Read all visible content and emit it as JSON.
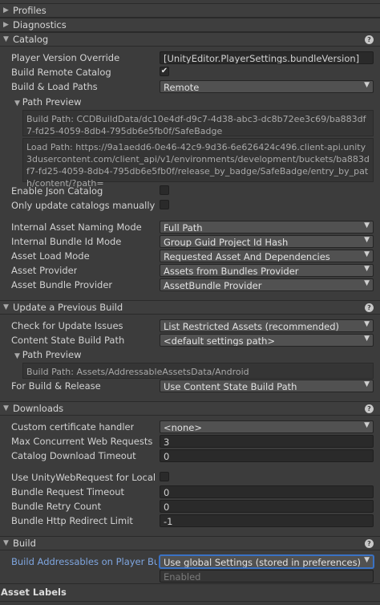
{
  "sections": {
    "profiles": "Profiles",
    "diagnostics": "Diagnostics",
    "catalog": "Catalog",
    "update_previous_build": "Update a Previous Build",
    "downloads": "Downloads",
    "build": "Build",
    "asset_labels": "Asset Labels"
  },
  "help_glyph": "?",
  "catalog": {
    "player_version_override_label": "Player Version Override",
    "player_version_override_value": "[UnityEditor.PlayerSettings.bundleVersion]",
    "build_remote_catalog_label": "Build Remote Catalog",
    "build_remote_catalog_checked": true,
    "build_load_paths_label": "Build & Load Paths",
    "build_load_paths_value": "Remote",
    "path_preview_label": "Path Preview",
    "build_path_preview": "Build Path: CCDBuildData/dc10e4df-d9c7-4d38-abc3-dc8b72ee3c69/ba883df7-fd25-4059-8db4-795db6e5fb0f/SafeBadge",
    "load_path_preview": "Load Path: https://9a1aedd6-0e46-42c9-9d36-6e626424c496.client-api.unity3dusercontent.com/client_api/v1/environments/development/buckets/ba883df7-fd25-4059-8db4-795db6e5fb0f/release_by_badge/SafeBadge/entry_by_path/content/?path=",
    "enable_json_catalog_label": "Enable Json Catalog",
    "only_update_manually_label": "Only update catalogs manually",
    "internal_asset_naming_label": "Internal Asset Naming Mode",
    "internal_asset_naming_value": "Full Path",
    "internal_bundle_id_label": "Internal Bundle Id Mode",
    "internal_bundle_id_value": "Group Guid Project Id Hash",
    "asset_load_mode_label": "Asset Load Mode",
    "asset_load_mode_value": "Requested Asset And Dependencies",
    "asset_provider_label": "Asset Provider",
    "asset_provider_value": "Assets from Bundles Provider",
    "asset_bundle_provider_label": "Asset Bundle Provider",
    "asset_bundle_provider_value": "AssetBundle Provider"
  },
  "update": {
    "check_issues_label": "Check for Update Issues",
    "check_issues_value": "List Restricted Assets (recommended)",
    "content_state_path_label": "Content State Build Path",
    "content_state_path_value": "<default settings path>",
    "path_preview_label": "Path Preview",
    "build_path_preview": "Build Path: Assets/AddressableAssetsData/Android",
    "for_build_release_label": "For Build & Release",
    "for_build_release_value": "Use Content State Build Path"
  },
  "downloads": {
    "cert_handler_label": "Custom certificate handler",
    "cert_handler_value": "<none>",
    "max_requests_label": "Max Concurrent Web Requests",
    "max_requests_value": "3",
    "catalog_timeout_label": "Catalog Download Timeout",
    "catalog_timeout_value": "0",
    "use_uwr_label": "Use UnityWebRequest for Local Asse",
    "bundle_timeout_label": "Bundle Request Timeout",
    "bundle_timeout_value": "0",
    "bundle_retry_label": "Bundle Retry Count",
    "bundle_retry_value": "0",
    "bundle_redirect_label": "Bundle Http Redirect Limit",
    "bundle_redirect_value": "-1"
  },
  "build": {
    "build_on_player_label": "Build Addressables on Player Build",
    "build_on_player_value": "Use global Settings (stored in preferences)",
    "enabled_text": "Enabled"
  },
  "colors": {
    "accent_label": "#7fa6e0",
    "focus_outline": "#3a72c4"
  }
}
